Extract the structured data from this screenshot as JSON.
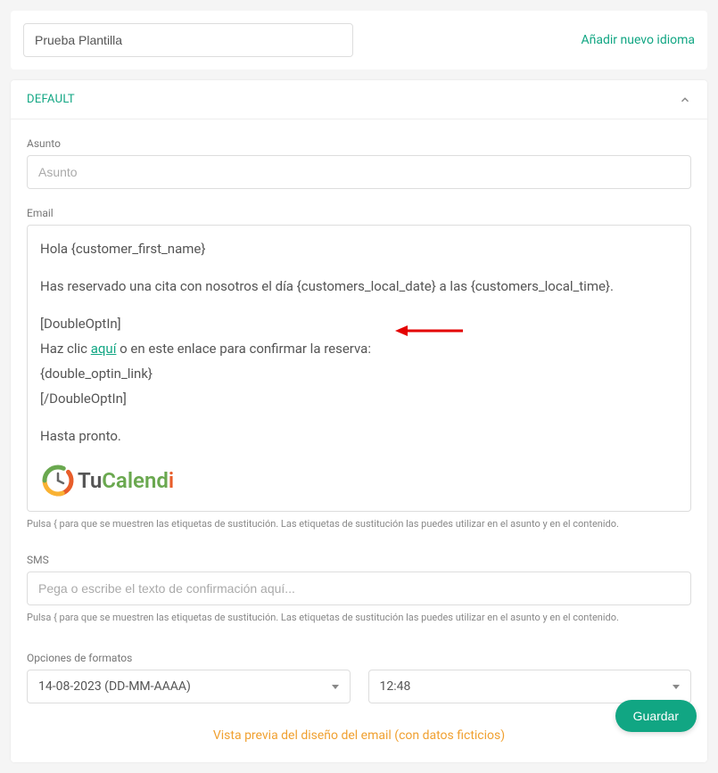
{
  "top": {
    "template_name": "Prueba Plantilla",
    "add_language": "Añadir nuevo idioma"
  },
  "panel": {
    "title": "DEFAULT"
  },
  "subject": {
    "label": "Asunto",
    "placeholder": "Asunto",
    "value": ""
  },
  "email": {
    "label": "Email",
    "body": {
      "line1": "Hola {customer_first_name}",
      "line2": "Has reservado una cita con  nosotros el día {customers_local_date} a las {customers_local_time}.",
      "doubleopt_open": "[DoubleOptIn]",
      "click_prefix": "Haz clic ",
      "click_link": "aquí",
      "click_suffix": " o en este enlace para confirmar la reserva:",
      "optin_link_token": "{double_optin_link}",
      "doubleopt_close": "[/DoubleOptIn]",
      "farewell": "Hasta pronto."
    },
    "help": "Pulsa { para que se muestren las etiquetas de sustitución. Las etiquetas de sustitución las puedes utilizar en el asunto y en el contenido.",
    "logo_text_tu": "Tu",
    "logo_text_calend": "Calend",
    "logo_text_i": "i"
  },
  "sms": {
    "label": "SMS",
    "placeholder": "Pega o escribe el texto de confirmación aquí...",
    "value": "",
    "help": "Pulsa { para que se muestren las etiquetas de sustitución. Las etiquetas de sustitución las puedes utilizar en el asunto y en el contenido."
  },
  "formats": {
    "label": "Opciones de formatos",
    "date": "14-08-2023 (DD-MM-AAAA)",
    "time": "12:48"
  },
  "preview_link": "Vista previa del diseño del email (con datos ficticios)",
  "save": "Guardar"
}
